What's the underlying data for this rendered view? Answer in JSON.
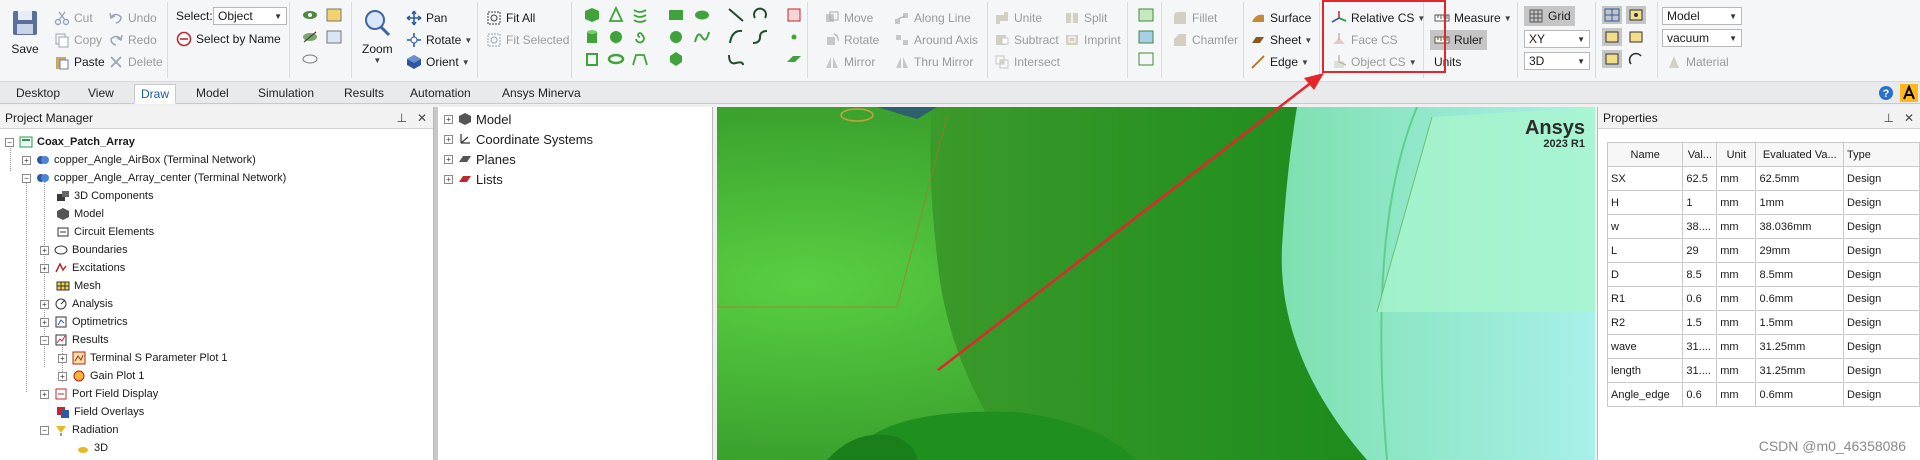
{
  "ribbon": {
    "clipboard": {
      "save": "Save",
      "cut": "Cut",
      "copy": "Copy",
      "paste": "Paste",
      "undo": "Undo",
      "redo": "Redo",
      "delete": "Delete"
    },
    "select": {
      "label": "Select:",
      "value": "Object",
      "by_name": "Select by Name"
    },
    "view": {
      "zoom": "Zoom",
      "pan": "Pan",
      "rotate": "Rotate",
      "orient": "Orient",
      "fit_all": "Fit All",
      "fit_selected": "Fit Selected"
    },
    "edit": {
      "move": "Move",
      "rotate": "Rotate",
      "mirror": "Mirror",
      "along_line": "Along Line",
      "around_axis": "Around Axis",
      "thru_mirror": "Thru Mirror"
    },
    "boolean": {
      "unite": "Unite",
      "subtract": "Subtract",
      "intersect": "Intersect",
      "split": "Split",
      "imprint": "Imprint"
    },
    "modify": {
      "fillet": "Fillet",
      "chamfer": "Chamfer"
    },
    "create": {
      "surface": "Surface",
      "sheet": "Sheet",
      "edge": "Edge"
    },
    "cs": {
      "relative": "Relative CS",
      "face": "Face CS",
      "object": "Object CS"
    },
    "measure": {
      "measure": "Measure",
      "ruler": "Ruler",
      "units": "Units"
    },
    "grid": {
      "grid": "Grid",
      "plane": "XY",
      "dim": "3D"
    },
    "material": {
      "model": "Model",
      "value": "vacuum",
      "material": "Material"
    }
  },
  "tabs": [
    "Desktop",
    "View",
    "Draw",
    "Model",
    "Simulation",
    "Results",
    "Automation",
    "Ansys Minerva"
  ],
  "active_tab": "Draw",
  "project_manager": {
    "title": "Project Manager",
    "items": [
      "Coax_Patch_Array",
      "copper_Angle_AirBox (Terminal Network)",
      "copper_Angle_Array_center (Terminal Network)",
      "3D Components",
      "Model",
      "Circuit Elements",
      "Boundaries",
      "Excitations",
      "Mesh",
      "Analysis",
      "Optimetrics",
      "Results",
      "Terminal S Parameter Plot 1",
      "Gain Plot 1",
      "Port Field Display",
      "Field Overlays",
      "Radiation",
      "3D"
    ]
  },
  "model_tree": {
    "items": [
      "Model",
      "Coordinate Systems",
      "Planes",
      "Lists"
    ]
  },
  "viewport": {
    "logo": "Ansys",
    "version": "2023 R1"
  },
  "properties": {
    "title": "Properties",
    "headers": [
      "Name",
      "Val...",
      "Unit",
      "Evaluated Va...",
      "Type"
    ],
    "rows": [
      [
        "SX",
        "62.5",
        "mm",
        "62.5mm",
        "Design"
      ],
      [
        "H",
        "1",
        "mm",
        "1mm",
        "Design"
      ],
      [
        "w",
        "38....",
        "mm",
        "38.036mm",
        "Design"
      ],
      [
        "L",
        "29",
        "mm",
        "29mm",
        "Design"
      ],
      [
        "D",
        "8.5",
        "mm",
        "8.5mm",
        "Design"
      ],
      [
        "R1",
        "0.6",
        "mm",
        "0.6mm",
        "Design"
      ],
      [
        "R2",
        "1.5",
        "mm",
        "1.5mm",
        "Design"
      ],
      [
        "wave",
        "31....",
        "mm",
        "31.25mm",
        "Design"
      ],
      [
        "length",
        "31....",
        "mm",
        "31.25mm",
        "Design"
      ],
      [
        "Angle_edge",
        "0.6",
        "mm",
        "0.6mm",
        "Design"
      ]
    ]
  },
  "watermark": "CSDN @m0_46358086",
  "colors": {
    "annotation": "#e4262c",
    "active_tab": "#1a5aa8",
    "model_green": "#2f9a1f",
    "model_cyan": "#9beee2"
  }
}
